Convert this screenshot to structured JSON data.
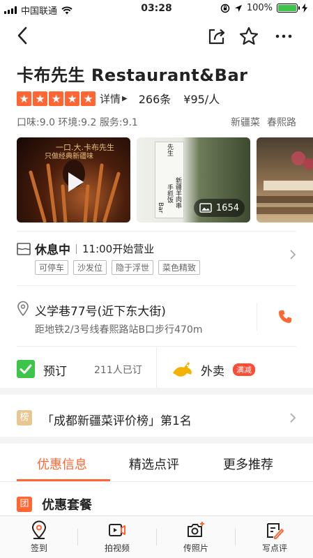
{
  "status_bar": {
    "carrier": "中国联通",
    "time": "03:28",
    "battery": "100%",
    "battery_level": 1.0
  },
  "nav": {
    "back_icon": "chevron-left-icon",
    "share_icon": "share-icon",
    "favorite_icon": "star-outline-icon",
    "more_icon": "more-icon"
  },
  "shop": {
    "name": "卡布先生 Restaurant&Bar",
    "star_rating": 5,
    "detail_label": "详情",
    "review_count": "266条",
    "price_per_person": "¥95/人",
    "scores": "口味:9.0  环境:9.2  服务:9.1",
    "cuisine_tag": "新疆菜",
    "area_tag": "春熙路"
  },
  "photos": {
    "video_caption_1": "一口.大.卡布先生",
    "video_caption_2": "只做经典新疆味",
    "sign_text_1": "先生",
    "sign_text_2": "新疆羊肉串",
    "sign_text_3": "手抓饭",
    "sign_text_4": "Bar",
    "photo_count": "1654"
  },
  "business": {
    "state": "休息中",
    "hours": "11:00开始营业",
    "features": [
      "可停车",
      "沙发位",
      "隐于浮世",
      "菜色精致"
    ]
  },
  "address": {
    "street": "义学巷77号(近下东大街)",
    "metro": "距地铁2/3号线春熙路站B口步行470m"
  },
  "actions": {
    "booking_label": "预订",
    "booking_count": "211人已订",
    "takeout_label": "外卖",
    "takeout_badge": "满减"
  },
  "ranking": {
    "badge": "榜",
    "text": "「成都新疆菜评价榜」第1名"
  },
  "tabs": [
    {
      "label": "优惠信息",
      "active": true
    },
    {
      "label": "精选点评",
      "active": false
    },
    {
      "label": "更多推荐",
      "active": false
    }
  ],
  "deal_section": {
    "badge": "团",
    "title": "优惠套餐"
  },
  "bottom_bar": [
    {
      "label": "签到",
      "icon": "location-pin-icon"
    },
    {
      "label": "拍视频",
      "icon": "video-camera-icon"
    },
    {
      "label": "传照片",
      "icon": "camera-plus-icon"
    },
    {
      "label": "写点评",
      "icon": "write-review-icon"
    }
  ],
  "colors": {
    "accent": "#ff6633",
    "star": "#ff6633",
    "booking_green": "#3cc548",
    "takeout_yellow": "#f2b300",
    "promo_red": "#ff4b33"
  }
}
